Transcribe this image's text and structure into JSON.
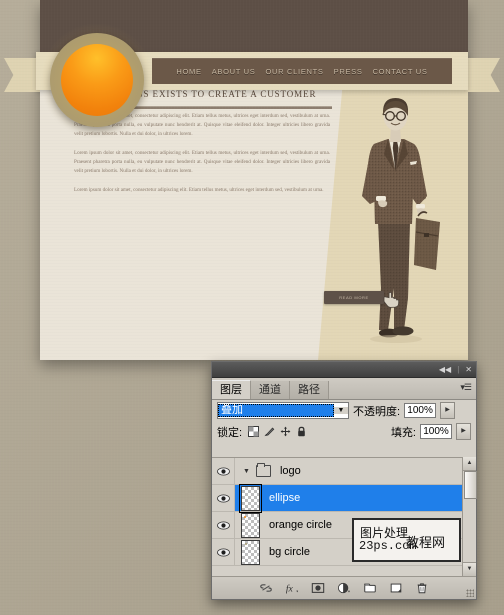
{
  "website": {
    "nav": [
      {
        "label": "HOME"
      },
      {
        "label": "ABOUT US"
      },
      {
        "label": "OUR CLIENTS"
      },
      {
        "label": "PRESS"
      },
      {
        "label": "CONTACT US"
      }
    ],
    "headline": "A BUSINESS EXISTS TO CREATE A CUSTOMER",
    "paragraphs": [
      "Lorem ipsum dolor sit amet, consectetur adipiscing elit. Etiam tellus metus, ultrices eget interdum sed, vestibulum at urna. Praesent pharetra porta nulla, eu vulputate nunc hendrerit at. Quisque vitae eleifend dolor. Integer ultricies libero gravida velit pretium lobortis. Nulla et dui dolor, in ultrices lorem.",
      "Lorem ipsum dolor sit amet, consectetur adipiscing elit. Etiam tellus metus, ultrices eget interdum sed, vestibulum at urna. Praesent pharetra porta nulla, eu vulputate nunc hendrerit at. Quisque vitae eleifend dolor. Integer ultricies libero gravida velit pretium lobortis. Nulla et dui dolor, in ultrices lorem.",
      "Lorem ipsum dolor sit amet, consectetur adipiscing elit. Etiam tellus metus, ultrices eget interdum sed, vestibulum at urna."
    ],
    "read_more_label": "READ MORE",
    "colors": {
      "header_bar": "#5d4f46",
      "nav_bar": "#6b5848",
      "page_bg": "#eae4d8",
      "ribbon": "#e6dcbe",
      "logo_orange": "#f2820c",
      "logo_ring": "#a8996f"
    }
  },
  "photoshop": {
    "titlebar": {
      "collapse_icon": "collapse-icon",
      "close_icon": "close-icon"
    },
    "tabs": [
      {
        "label": "图层",
        "active": true
      },
      {
        "label": "通道",
        "active": false
      },
      {
        "label": "路径",
        "active": false
      }
    ],
    "panel_menu_icon": "panel-menu-icon",
    "blend_mode": {
      "value": "叠加",
      "arrow_icon": "chevron-down-icon"
    },
    "opacity": {
      "label": "不透明度:",
      "value": "100%",
      "spin_icon": "spinner-arrow-icon"
    },
    "lock": {
      "label": "锁定:",
      "icons": [
        "lock-transparent-pixels-icon",
        "lock-image-pixels-icon",
        "lock-position-icon",
        "lock-all-icon"
      ]
    },
    "fill": {
      "label": "填充:",
      "value": "100%",
      "spin_icon": "spinner-arrow-icon"
    },
    "layers": [
      {
        "name": "logo",
        "type": "group",
        "visible": true,
        "expanded": true,
        "selected": false
      },
      {
        "name": "ellipse",
        "type": "layer",
        "visible": true,
        "selected": true
      },
      {
        "name": "orange circle",
        "type": "layer",
        "visible": true,
        "selected": false
      },
      {
        "name": "bg circle",
        "type": "layer",
        "visible": true,
        "selected": false
      }
    ],
    "scrollbar": {
      "up_icon": "scroll-up-icon",
      "down_icon": "scroll-down-icon"
    },
    "bottom_toolbar": [
      {
        "icon": "link-layers-icon"
      },
      {
        "icon": "layer-style-fx-icon"
      },
      {
        "icon": "add-layer-mask-icon"
      },
      {
        "icon": "adjustment-layer-icon"
      },
      {
        "icon": "new-group-icon"
      },
      {
        "icon": "new-layer-icon"
      },
      {
        "icon": "delete-layer-icon"
      }
    ],
    "selection_color": "#1f7fea",
    "panel_bg": "#d4d0c8"
  },
  "watermark": {
    "line1": "图片处理",
    "line2": "23ps.com",
    "line3": "教程网"
  }
}
